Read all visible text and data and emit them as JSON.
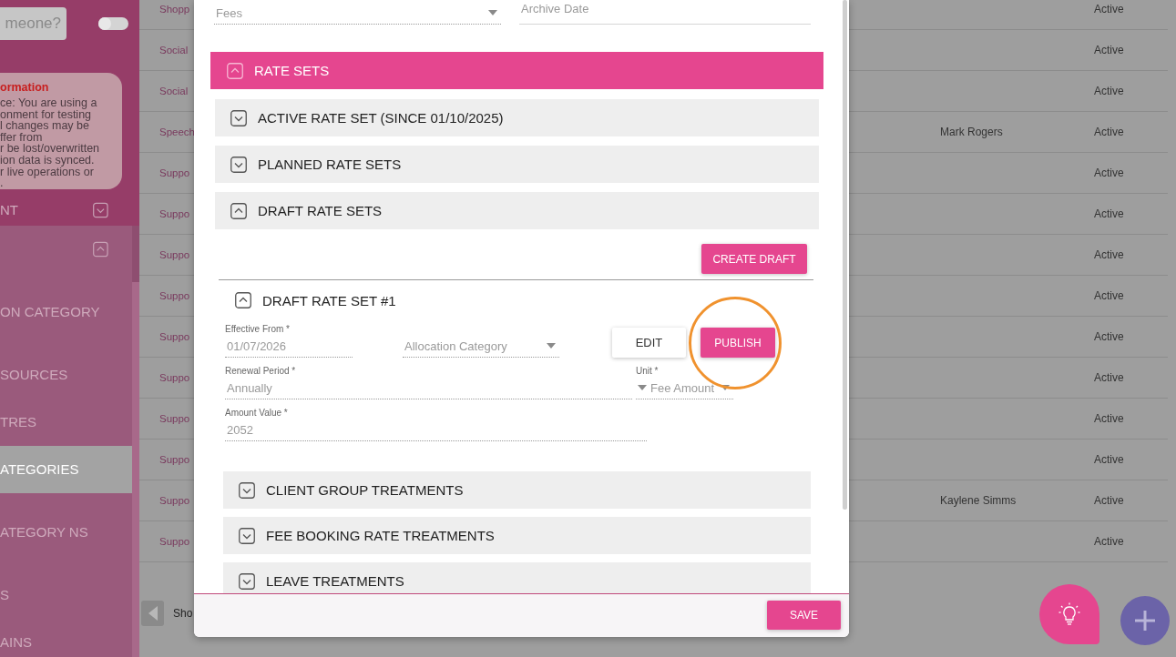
{
  "sidebar": {
    "search": {
      "placeholder": "meone?"
    },
    "toggle": {
      "on": false
    },
    "info": {
      "title": "ormation",
      "lines": [
        "ce: You are using a",
        "onment for testing",
        "l changes may be",
        "ffer from",
        "r be lost/overwritten",
        "ion data is synced.",
        "r live operations or",
        "."
      ]
    },
    "nav": [
      {
        "label": "NT",
        "expanded": false,
        "selected": false
      },
      {
        "expanded": true,
        "selected": false
      },
      {
        "label": "ON CATEGORY",
        "selected": false
      },
      {
        "label": "SOURCES",
        "selected": false
      },
      {
        "label": "TRES",
        "selected": false
      },
      {
        "label": "ATEGORIES",
        "selected": true
      },
      {
        "label": "ATEGORY NS",
        "selected": false
      },
      {
        "label": "S",
        "selected": false
      },
      {
        "label": "AINS",
        "selected": false
      }
    ]
  },
  "table": {
    "rows": [
      {
        "column_1": "Shopp",
        "column_3": "Active"
      },
      {
        "column_1": "Social",
        "column_3": "Active"
      },
      {
        "column_1": "Social",
        "column_3": "Active"
      },
      {
        "column_1": "Speech",
        "column_2": "Mark Rogers",
        "column_3": "Active"
      },
      {
        "column_1": "Suppo",
        "column_3": "Active"
      },
      {
        "column_1": "Suppo",
        "column_3": "Active"
      },
      {
        "column_1": "Suppo",
        "column_3": "Active"
      },
      {
        "column_1": "Suppo",
        "column_3": "Active"
      },
      {
        "column_1": "Suppo",
        "column_3": "Active"
      },
      {
        "column_1": "Suppo",
        "column_3": "Active"
      },
      {
        "column_1": "Suppo",
        "column_3": "Active"
      },
      {
        "column_1": "Suppo",
        "column_3": "Active"
      },
      {
        "column_1": "Suppo",
        "column_2": "Kaylene Simms",
        "column_3": "Active"
      },
      {
        "column_1": "Suppo",
        "column_3": "Active"
      }
    ],
    "pager": {
      "text": "Sho"
    }
  },
  "modal": {
    "type_field": {
      "value": "Fees"
    },
    "archive_date": {
      "placeholder": "Archive Date"
    },
    "rate_sets": {
      "title": "RATE SETS",
      "expanded": true,
      "sections": [
        {
          "title": "ACTIVE RATE SET (SINCE 01/10/2025)",
          "expanded": false
        },
        {
          "title": "PLANNED RATE SETS",
          "expanded": false
        },
        {
          "title": "DRAFT RATE SETS",
          "expanded": true
        }
      ]
    },
    "create_draft_button": "CREATE DRAFT",
    "draft": {
      "title": "DRAFT RATE SET #1",
      "expanded": true,
      "effective_from": {
        "label": "Effective From *",
        "value": "01/07/2026"
      },
      "allocation_category": {
        "placeholder": "Allocation Category"
      },
      "edit_button": "EDIT",
      "publish_button": {
        "label": "PUBLISH",
        "highlighted": true
      },
      "renewal_period": {
        "label": "Renewal Period *",
        "value": "Annually"
      },
      "unit": {
        "label": "Unit *",
        "value": "Fee Amount"
      },
      "amount_value": {
        "label": "Amount Value *",
        "value": "2052"
      }
    },
    "treatments": [
      {
        "title": "CLIENT GROUP TREATMENTS",
        "expanded": false
      },
      {
        "title": "FEE BOOKING RATE TREATMENTS",
        "expanded": false
      },
      {
        "title": "LEAVE TREATMENTS",
        "expanded": false
      }
    ],
    "save_button": "SAVE"
  }
}
